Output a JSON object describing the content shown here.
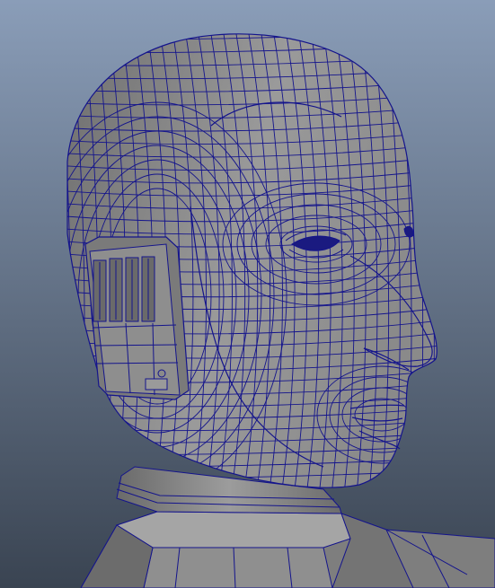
{
  "viewport": {
    "background_top": "#8a9db8",
    "background_bottom": "#3a4452",
    "mesh_fill": "#8c8c8c",
    "mesh_shadow": "#5a5a5a",
    "wire_color": "#14148c"
  },
  "scene": {
    "object": "head-mesh",
    "display_mode": "shaded-wireframe"
  }
}
